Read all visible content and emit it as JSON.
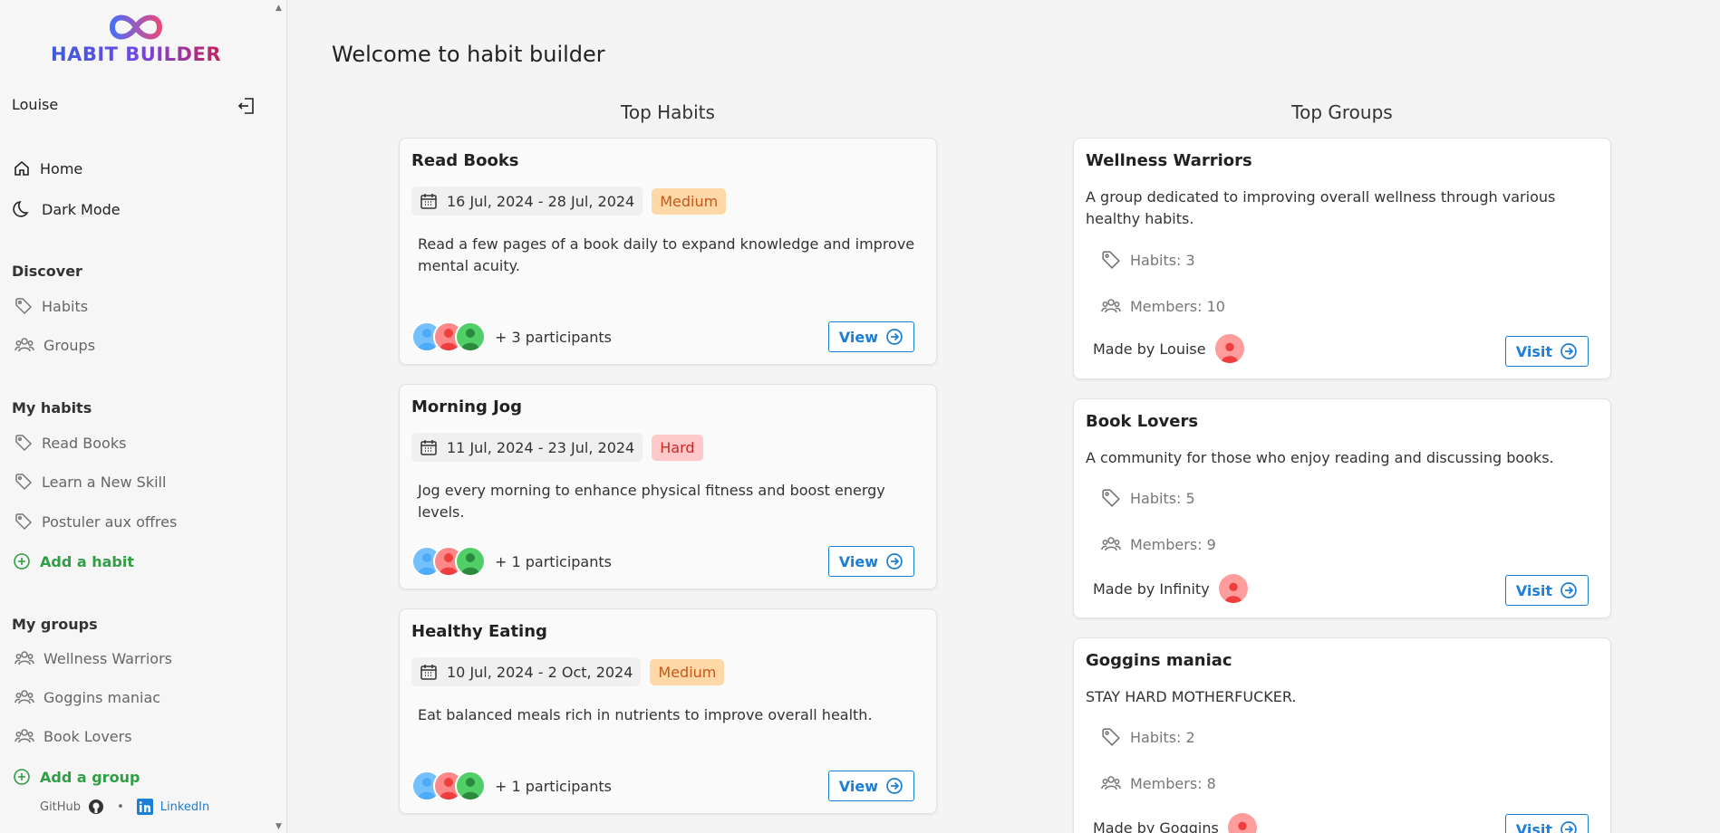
{
  "sidebar": {
    "logo_text": "HABIT BUILDER",
    "user_name": "Louise",
    "nav": {
      "home": "Home",
      "dark_mode": "Dark Mode"
    },
    "discover": {
      "title": "Discover",
      "habits": "Habits",
      "groups": "Groups"
    },
    "my_habits": {
      "title": "My habits",
      "items": [
        "Read Books",
        "Learn a New Skill",
        "Postuler aux offres"
      ],
      "add": "Add a habit"
    },
    "my_groups": {
      "title": "My groups",
      "items": [
        "Wellness Warriors",
        "Goggins maniac",
        "Book Lovers"
      ],
      "add": "Add a group"
    },
    "footer": {
      "github": "GitHub",
      "separator": "•",
      "linkedin": "LinkedIn"
    }
  },
  "main": {
    "title": "Welcome to habit builder",
    "top_habits_title": "Top Habits",
    "top_groups_title": "Top Groups",
    "habits": [
      {
        "title": "Read Books",
        "dates": "16 Jul, 2024 - 28 Jul, 2024",
        "difficulty": "Medium",
        "description": "Read a few pages of a book daily to expand knowledge and improve mental acuity.",
        "participants": "+ 3 participants",
        "button": "View"
      },
      {
        "title": "Morning Jog",
        "dates": "11 Jul, 2024 - 23 Jul, 2024",
        "difficulty": "Hard",
        "description": "Jog every morning to enhance physical fitness and boost energy levels.",
        "participants": "+ 1 participants",
        "button": "View"
      },
      {
        "title": "Healthy Eating",
        "dates": "10 Jul, 2024 - 2 Oct, 2024",
        "difficulty": "Medium",
        "description": "Eat balanced meals rich in nutrients to improve overall health.",
        "participants": "+ 1 participants",
        "button": "View"
      }
    ],
    "groups": [
      {
        "title": "Wellness Warriors",
        "description": "A group dedicated to improving overall wellness through various healthy habits.",
        "habits": "Habits: 3",
        "members": "Members: 10",
        "made_by": "Made by Louise",
        "button": "Visit"
      },
      {
        "title": "Book Lovers",
        "description": "A community for those who enjoy reading and discussing books.",
        "habits": "Habits: 5",
        "members": "Members: 9",
        "made_by": "Made by Infinity",
        "button": "Visit"
      },
      {
        "title": "Goggins maniac",
        "description": "STAY HARD MOTHERFUCKER.",
        "habits": "Habits: 2",
        "members": "Members: 8",
        "made_by": "Made by Goggins",
        "button": "Visit"
      }
    ]
  },
  "colors": {
    "accent": "#1c7ed6",
    "add_green": "#2f9e44",
    "medium_badge": "#ffd8a8",
    "hard_badge": "#ffc9c9"
  }
}
